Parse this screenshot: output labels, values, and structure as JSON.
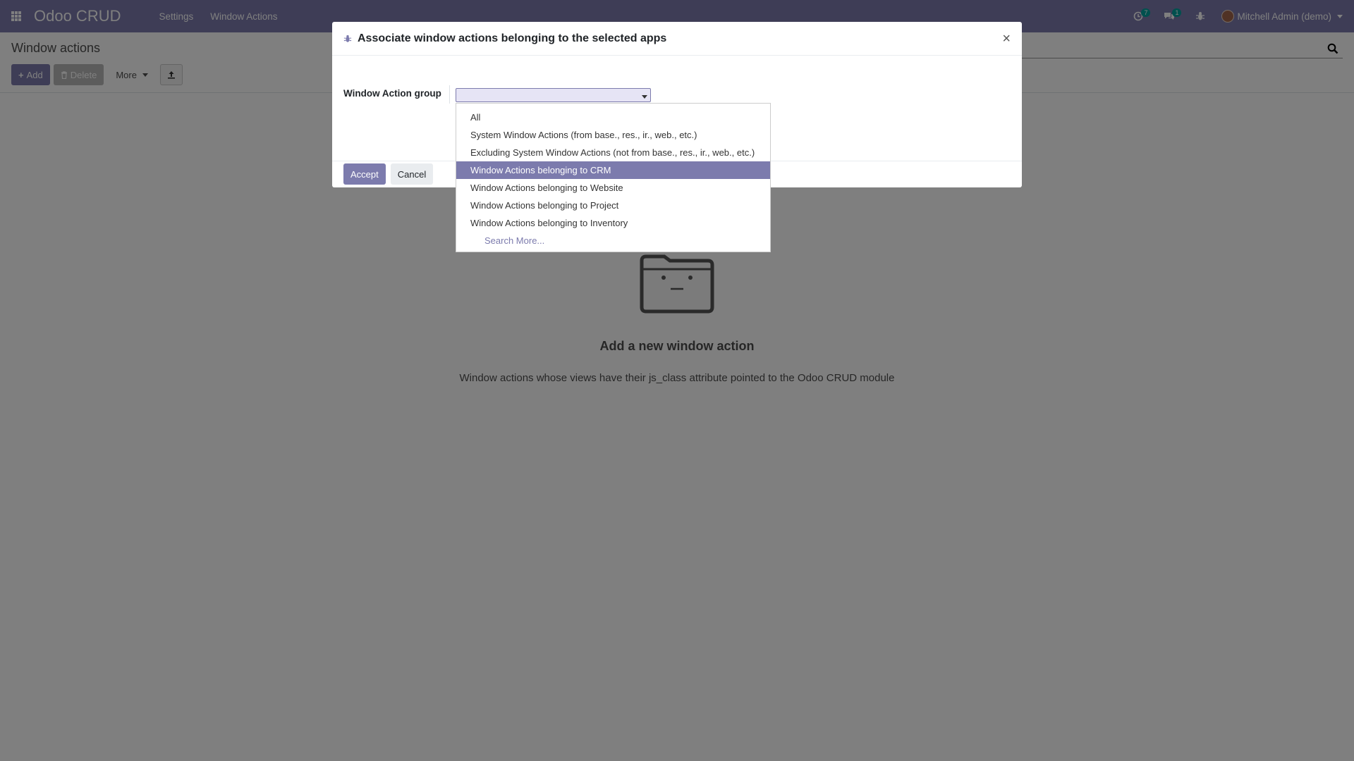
{
  "navbar": {
    "brand": "Odoo CRUD",
    "menus": [
      "Settings",
      "Window Actions"
    ],
    "activity_count": "7",
    "message_count": "1",
    "user_name": "Mitchell Admin (demo)",
    "color": "#7c7bad"
  },
  "control_panel": {
    "title": "Window actions",
    "add_label": "Add",
    "delete_label": "Delete",
    "more_label": "More"
  },
  "empty_state": {
    "title": "Add a new window action",
    "text": "Window actions whose views have their js_class attribute pointed to the Odoo CRUD module"
  },
  "modal": {
    "title": "Associate window actions belonging to the selected apps",
    "close_symbol": "×",
    "field_label": "Window Action group",
    "field_value": "",
    "accept_label": "Accept",
    "cancel_label": "Cancel"
  },
  "dropdown": {
    "options": [
      "All",
      "System Window Actions (from base., res., ir., web., etc.)",
      "Excluding System Window Actions (not from base., res., ir., web., etc.)",
      "Window Actions belonging to CRM",
      "Window Actions belonging to Website",
      "Window Actions belonging to Project",
      "Window Actions belonging to Inventory"
    ],
    "highlighted": "Window Actions belonging to CRM",
    "search_more": "Search More..."
  }
}
